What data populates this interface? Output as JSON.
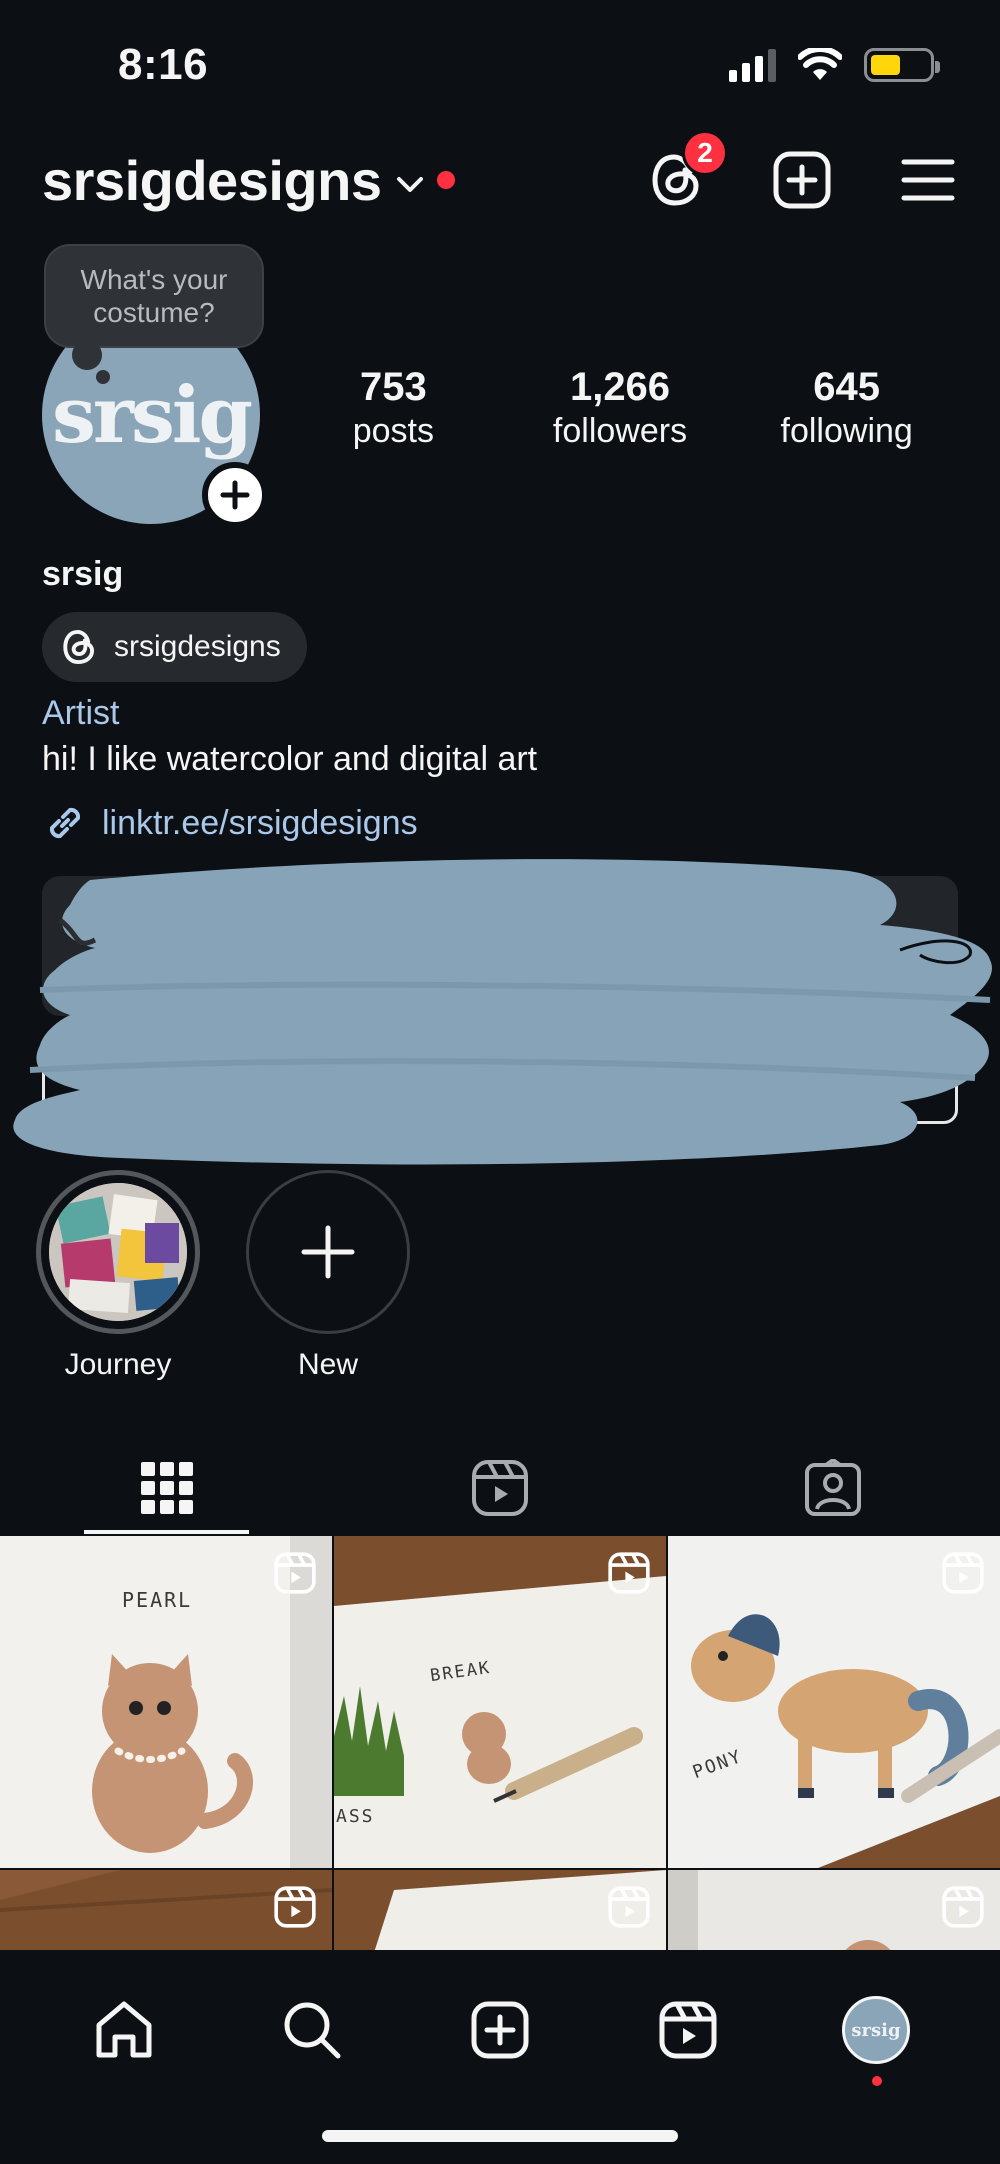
{
  "status_bar": {
    "time": "8:16"
  },
  "header": {
    "username": "srsigdesigns",
    "threads_badge": "2"
  },
  "note": {
    "text": "What's your costume?"
  },
  "profile": {
    "avatar_text": "srsig",
    "stats": [
      {
        "value": "753",
        "label": "posts"
      },
      {
        "value": "1,266",
        "label": "followers"
      },
      {
        "value": "645",
        "label": "following"
      }
    ],
    "display_name": "srsig",
    "threads_handle": "srsigdesigns",
    "category": "Artist",
    "bio": "hi! I like watercolor and digital art",
    "link": "linktr.ee/srsigdesigns"
  },
  "highlights": [
    {
      "label": "Journey"
    },
    {
      "label": "New"
    }
  ],
  "grid": {
    "captions": [
      "PEARL",
      "BREAK",
      "PONY",
      "ASS"
    ]
  },
  "colors": {
    "background": "#0c1014",
    "accent_link": "#a9c8ea",
    "notification": "#ff3040",
    "redaction": "#87a3b8"
  }
}
